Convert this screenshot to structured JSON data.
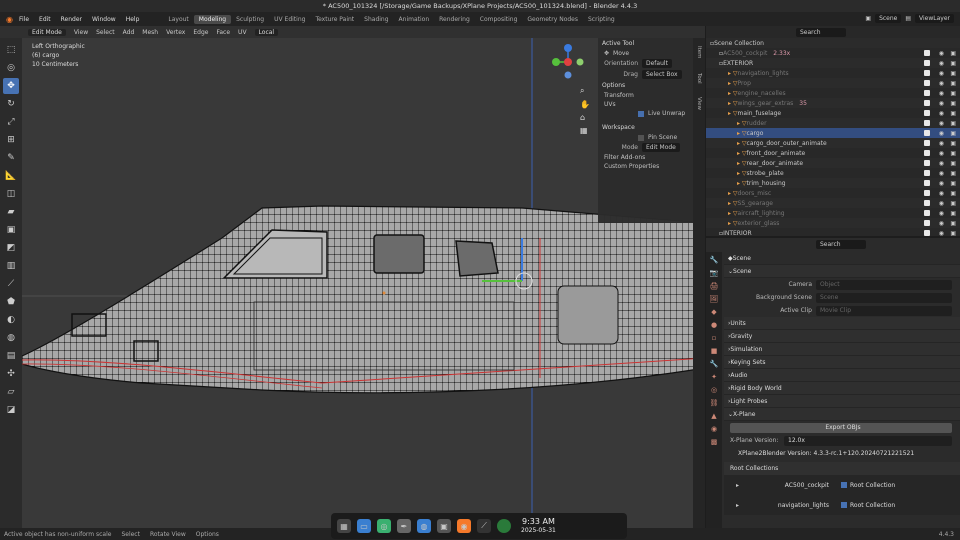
{
  "window": {
    "title": "* AC500_101324 [/Storage/Game Backups/XPlane Projects/AC500_101324.blend] - Blender 4.4.3"
  },
  "menu": [
    "File",
    "Edit",
    "Render",
    "Window",
    "Help"
  ],
  "workspaces": [
    {
      "label": "Layout"
    },
    {
      "label": "Modeling"
    },
    {
      "label": "Sculpting"
    },
    {
      "label": "UV Editing"
    },
    {
      "label": "Texture Paint"
    },
    {
      "label": "Shading"
    },
    {
      "label": "Animation"
    },
    {
      "label": "Rendering"
    },
    {
      "label": "Compositing"
    },
    {
      "label": "Geometry Nodes"
    },
    {
      "label": "Scripting"
    }
  ],
  "active_workspace": "Modeling",
  "topright": {
    "scene": "Scene",
    "viewlayer": "ViewLayer"
  },
  "viewport_header": {
    "mode": "Edit Mode",
    "items": [
      "View",
      "Select",
      "Add",
      "Mesh",
      "Vertex",
      "Edge",
      "Face",
      "UV"
    ],
    "orientation": "Local"
  },
  "viewport_info": {
    "view": "Left Orthographic",
    "object": "(6) cargo",
    "scale": "10 Centimeters"
  },
  "npanel": {
    "active_tool": "Active Tool",
    "tool": "Move",
    "orientation_label": "Orientation",
    "orientation_value": "Default",
    "drag_label": "Drag",
    "drag_value": "Select Box",
    "options": "Options",
    "transform": "Transform",
    "uvs": "UVs",
    "live_unwrap": "Live Unwrap",
    "workspace": "Workspace",
    "pin_scene": "Pin Scene",
    "mode_label": "Mode",
    "mode_value": "Edit Mode",
    "filter_addons": "Filter Add-ons",
    "custom_props": "Custom Properties"
  },
  "npanel_tabs": [
    "Item",
    "Tool",
    "View"
  ],
  "outliner": {
    "search_placeholder": "Search",
    "rows": [
      {
        "name": "Scene Collection",
        "indent": 0
      },
      {
        "name": "AC500_cockpit",
        "indent": 1,
        "extra": "2.33x",
        "dim": true
      },
      {
        "name": "EXTERIOR",
        "indent": 1
      },
      {
        "name": "navigation_lights",
        "indent": 2,
        "dim": true
      },
      {
        "name": "Prop",
        "indent": 2,
        "dim": true
      },
      {
        "name": "engine_nacelles",
        "indent": 2,
        "dim": true
      },
      {
        "name": "wings_gear_extras",
        "indent": 2,
        "extra": "35",
        "dim": true
      },
      {
        "name": "main_fuselage",
        "indent": 2
      },
      {
        "name": "rudder",
        "indent": 3,
        "dim": true
      },
      {
        "name": "cargo",
        "indent": 3,
        "selected": true
      },
      {
        "name": "cargo_door_outer_animate",
        "indent": 3
      },
      {
        "name": "front_door_animate",
        "indent": 3
      },
      {
        "name": "rear_door_animate",
        "indent": 3
      },
      {
        "name": "strobe_plate",
        "indent": 3
      },
      {
        "name": "trim_housing",
        "indent": 3
      },
      {
        "name": "doors_misc",
        "indent": 2,
        "dim": true
      },
      {
        "name": "SS_gearage",
        "indent": 2,
        "dim": true
      },
      {
        "name": "aircraft_lighting",
        "indent": 2,
        "dim": true
      },
      {
        "name": "exterior_glass",
        "indent": 2,
        "dim": true
      },
      {
        "name": "INTERIOR",
        "indent": 1
      }
    ]
  },
  "properties": {
    "search_placeholder": "Search",
    "title": "Scene",
    "scene_panel": "Scene",
    "camera_label": "Camera",
    "camera_ph": "Object",
    "bg_label": "Background Scene",
    "bg_ph": "Scene",
    "clip_label": "Active Clip",
    "clip_ph": "Movie Clip",
    "panels": [
      "Units",
      "Gravity",
      "Simulation",
      "Keying Sets",
      "Audio",
      "Rigid Body World",
      "Light Probes"
    ],
    "xplane": "X-Plane",
    "export_btn": "Export OBJs",
    "xpv_label": "X-Plane Version:",
    "xpv_value": "12.0x",
    "x2b": "XPlane2Blender Version: 4.3.3-rc.1+120.20240721221521",
    "root": "Root Collections",
    "roots": [
      {
        "name": "AC500_cockpit",
        "tag": "Root Collection"
      },
      {
        "name": "navigation_lights",
        "tag": "Root Collection"
      }
    ]
  },
  "status": {
    "warning": "Active object has non-uniform scale",
    "select": "Select",
    "rotate": "Rotate View",
    "options": "Options",
    "version": "4.4.3"
  },
  "clock": {
    "time": "9:33 AM",
    "date": "2025-05-31"
  },
  "colors": {
    "accent": "#4772b3",
    "selected_row": "#334d80",
    "blender_orange": "#f5792a"
  }
}
